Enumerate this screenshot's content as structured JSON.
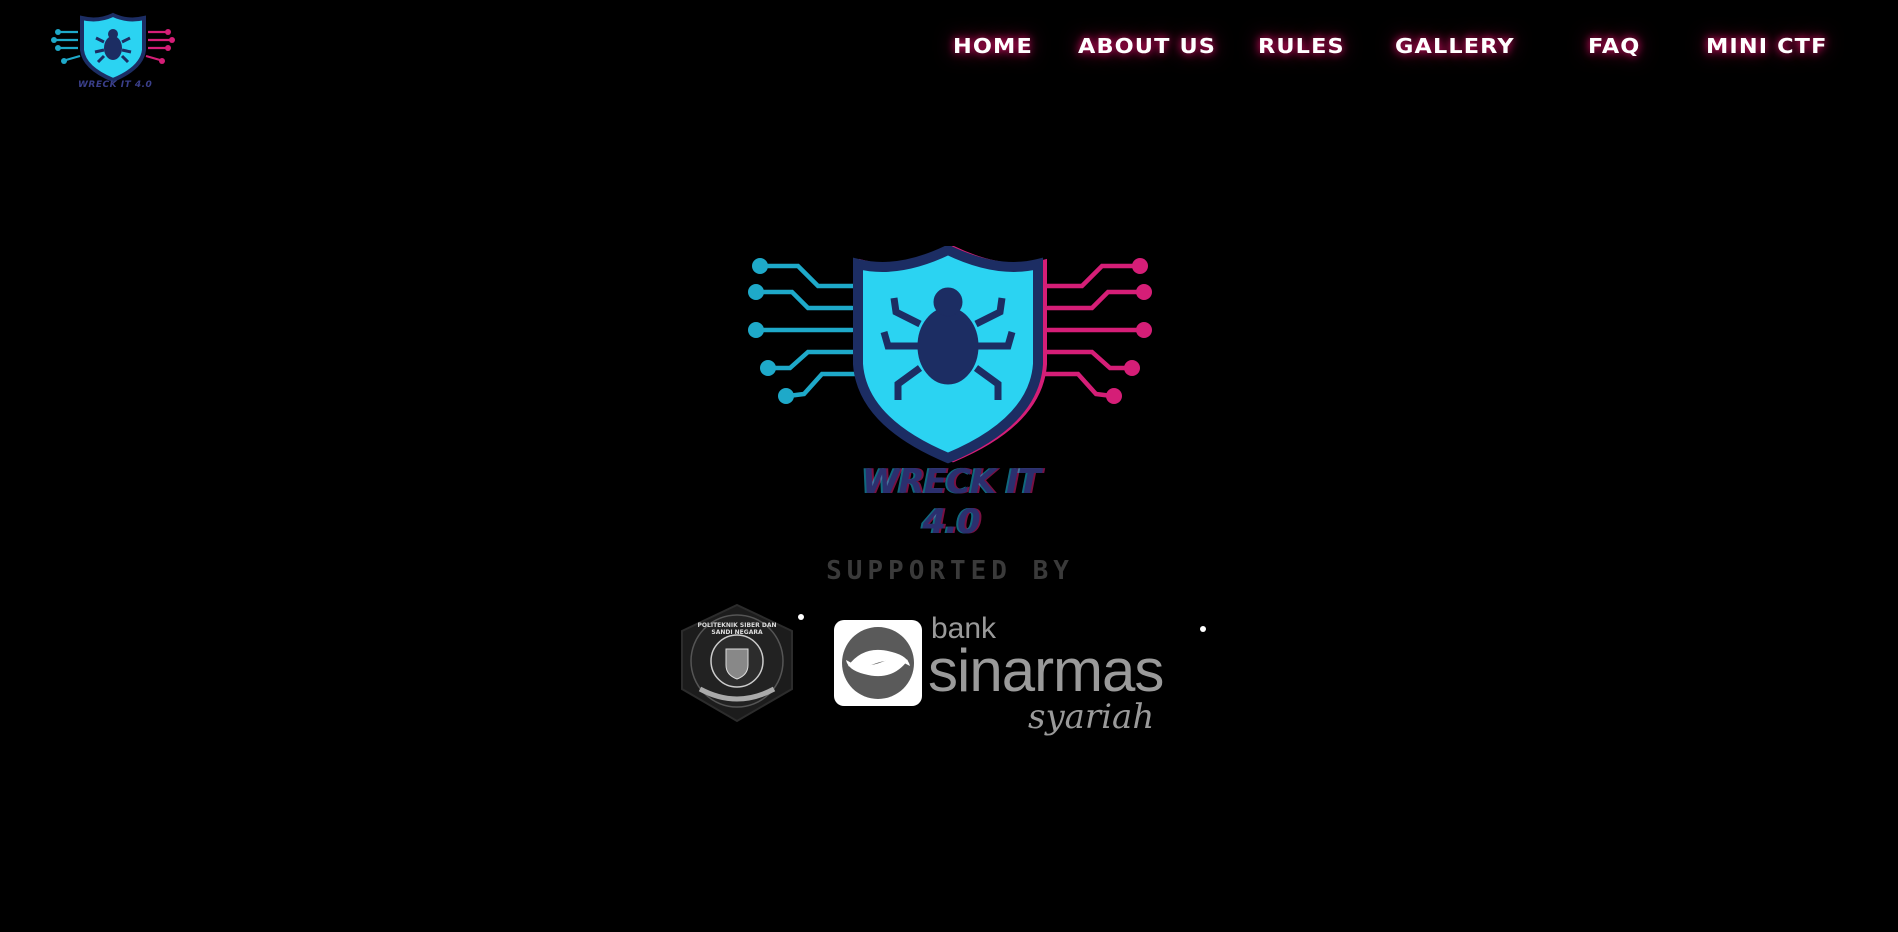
{
  "header": {
    "logo_text": "WRECK IT 4.0",
    "nav": [
      "HOME",
      "ABOUT US",
      "RULES",
      "GALLERY",
      "FAQ",
      "MINI CTF"
    ]
  },
  "hero": {
    "title": "WRECK IT 4.0",
    "supported_label": "SUPPORTED BY"
  },
  "sponsors": {
    "seal_text": "POLITEKNIK SIBER DAN SANDI NEGARA",
    "bank_small": "bank",
    "bank_name": "sinarmas",
    "bank_sub": "syariah"
  },
  "colors": {
    "background": "#000000",
    "cyan": "#2bd3f2",
    "magenta": "#e3207a",
    "title_indigo": "#2b2f6e",
    "sponsor_gray": "#9a9a9a"
  },
  "icons": [
    "shield-bug-logo-icon",
    "circuit-lines-icon",
    "university-seal-icon",
    "bank-swirl-icon"
  ]
}
